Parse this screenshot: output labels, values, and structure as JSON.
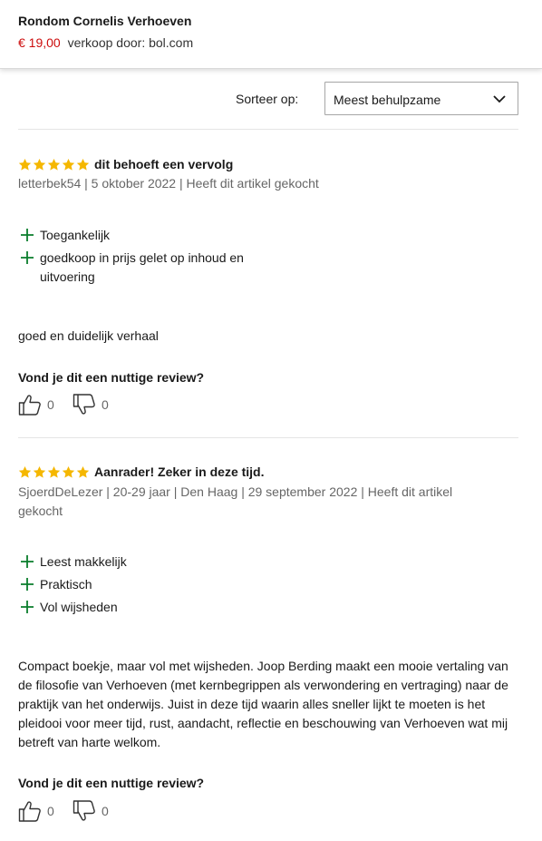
{
  "product": {
    "title": "Rondom Cornelis Verhoeven",
    "price": "€ 19,00",
    "seller": "verkoop door: bol.com"
  },
  "sort": {
    "label": "Sorteer op:",
    "selected": "Meest behulpzame"
  },
  "colors": {
    "star": "#f5b700",
    "price": "#cc0c0c",
    "pro_plus": "#0a7d2c"
  },
  "reviews": [
    {
      "rating": 5,
      "title": "dit behoeft een vervolg",
      "meta": "letterbek54 | 5 oktober 2022 | Heeft dit artikel gekocht",
      "pros": [
        "Toegankelijk",
        "goedkoop in prijs gelet op inhoud en uitvoering"
      ],
      "body": "goed en duidelijk verhaal",
      "helpful_question": "Vond je dit een nuttige review?",
      "likes": "0",
      "dislikes": "0"
    },
    {
      "rating": 5,
      "title": "Aanrader! Zeker in deze tijd.",
      "meta": "SjoerdDeLezer | 20-29 jaar | Den Haag | 29 september 2022 | Heeft dit artikel gekocht",
      "pros": [
        "Leest makkelijk",
        "Praktisch",
        "Vol wijsheden"
      ],
      "body": "Compact boekje, maar vol met wijsheden. Joop Berding maakt een mooie vertaling van de filosofie van Verhoeven (met kernbegrippen als verwondering en vertraging) naar de praktijk van het onderwijs. Juist in deze tijd waarin alles sneller lijkt te moeten is het pleidooi voor meer tijd, rust, aandacht, reflectie en beschouwing van Verhoeven wat mij betreft van harte welkom.",
      "helpful_question": "Vond je dit een nuttige review?",
      "likes": "0",
      "dislikes": "0"
    }
  ]
}
